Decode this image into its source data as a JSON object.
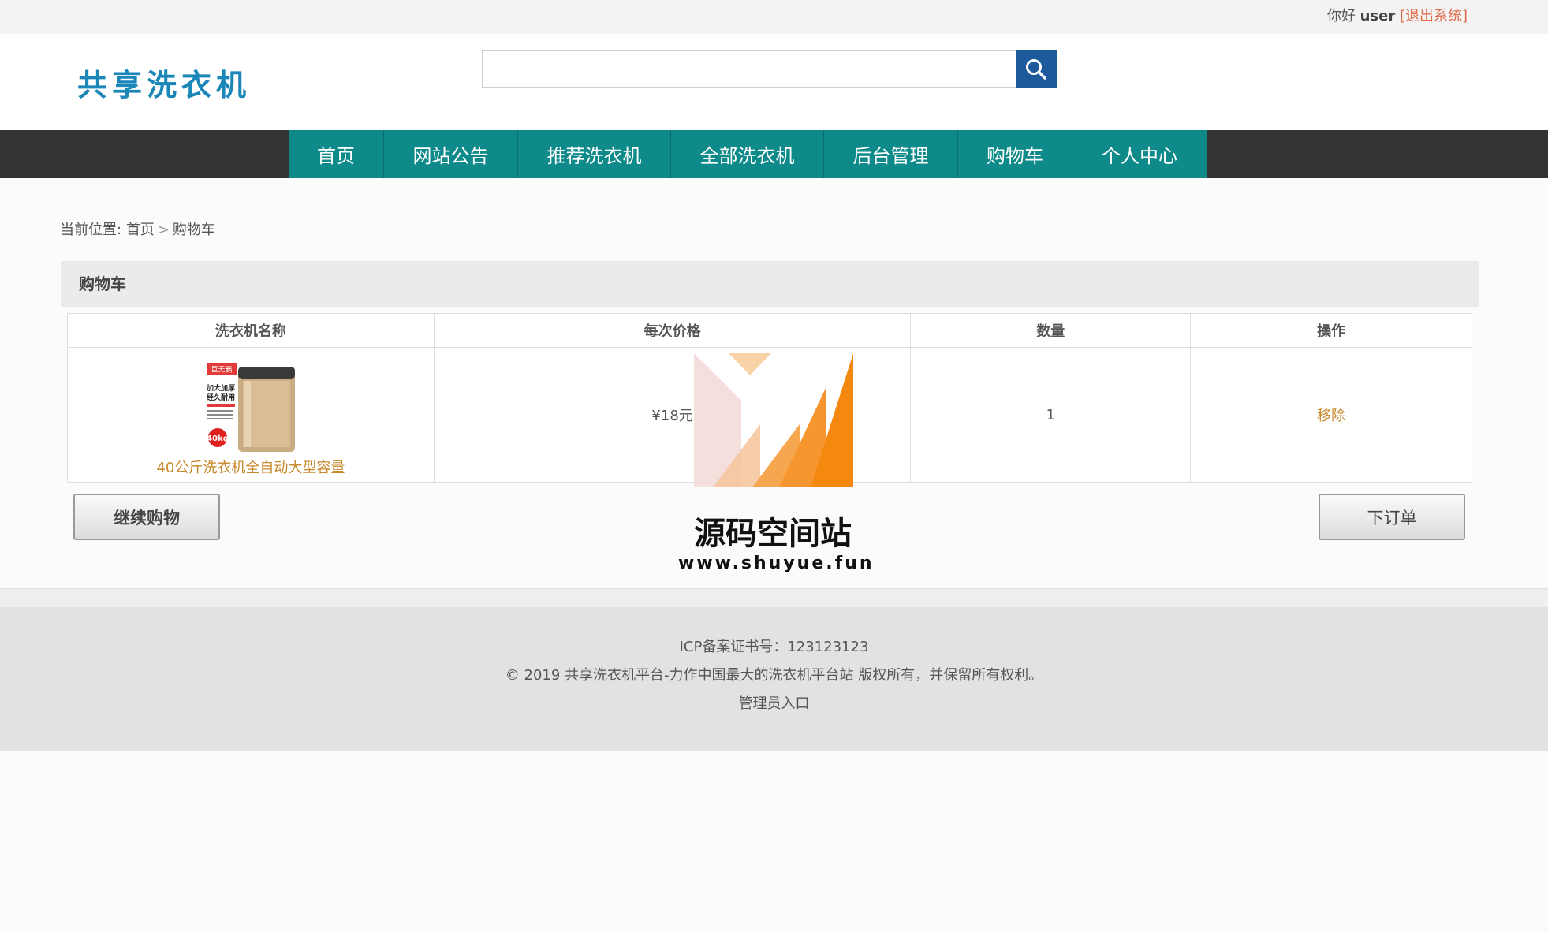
{
  "topbar": {
    "greeting": "你好",
    "username": "user",
    "logout": "[退出系统]"
  },
  "header": {
    "logo_text": "共享洗衣机",
    "search": {
      "value": "",
      "placeholder": ""
    }
  },
  "nav": {
    "items": [
      {
        "label": "首页"
      },
      {
        "label": "网站公告"
      },
      {
        "label": "推荐洗衣机"
      },
      {
        "label": "全部洗衣机"
      },
      {
        "label": "后台管理"
      },
      {
        "label": "购物车"
      },
      {
        "label": "个人中心"
      }
    ]
  },
  "breadcrumb": {
    "prefix": "当前位置:",
    "home": "首页",
    "separator": ">",
    "current": "购物车"
  },
  "cart": {
    "title": "购物车",
    "columns": [
      "洗衣机名称",
      "每次价格",
      "数量",
      "操作"
    ],
    "rows": [
      {
        "name": "40公斤洗衣机全自动大型容量",
        "price": "¥18元",
        "quantity": "1",
        "action": "移除",
        "image_badge": "巨无霸",
        "image_text1": "加大加厚",
        "image_text2": "经久耐用",
        "image_capacity": "40kg"
      }
    ],
    "continue_button": "继续购物",
    "order_button": "下订单"
  },
  "watermark": {
    "title": "源码空间站",
    "url": "www.shuyue.fun"
  },
  "footer": {
    "icp": "ICP备案证书号：123123123",
    "copyright": "© 2019 共享洗衣机平台-力作中国最大的洗衣机平台站 版权所有，并保留所有权利。",
    "admin_link": "管理员入口"
  },
  "colors": {
    "nav_bg": "#333333",
    "nav_active": "#0f8a8a",
    "search_button": "#1c5a9c",
    "link_orange": "#c8892b",
    "logout_red": "#e06b4b",
    "logo_blue": "#1a87b8"
  }
}
